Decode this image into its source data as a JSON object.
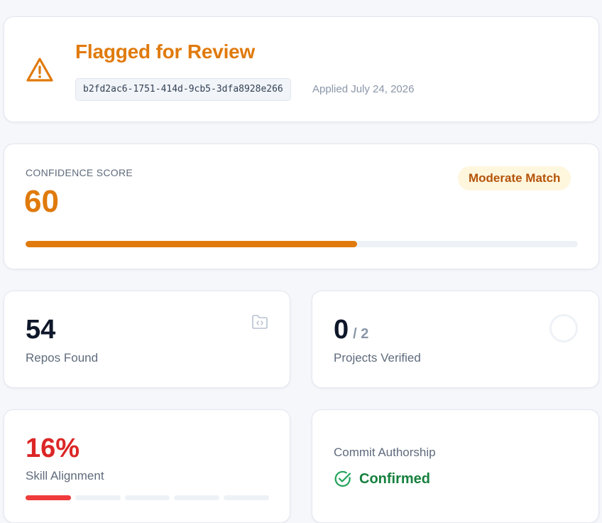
{
  "header": {
    "status": "Flagged for Review",
    "application_id": "b2fd2ac6-1751-414d-9cb5-3dfa8928e266",
    "applied": "Applied July 24, 2026",
    "icon": "warning-triangle-icon"
  },
  "confidence": {
    "label": "CONFIDENCE SCORE",
    "score": "60",
    "score_fraction": 0.6,
    "badge": "Moderate Match",
    "accent_color": "#e07a0c"
  },
  "repos": {
    "count": "54",
    "label": "Repos Found",
    "icon": "folder-code-icon"
  },
  "projects": {
    "verified": "0",
    "total": "/ 2",
    "label": "Projects Verified",
    "icon": "progress-ring-icon"
  },
  "skill": {
    "percent": "16%",
    "label": "Skill Alignment",
    "segments_total": 5,
    "segments_filled": 1,
    "color": "#dc2626"
  },
  "commit": {
    "label": "Commit Authorship",
    "status": "Confirmed",
    "icon": "check-circle-icon",
    "color": "#15803d"
  }
}
